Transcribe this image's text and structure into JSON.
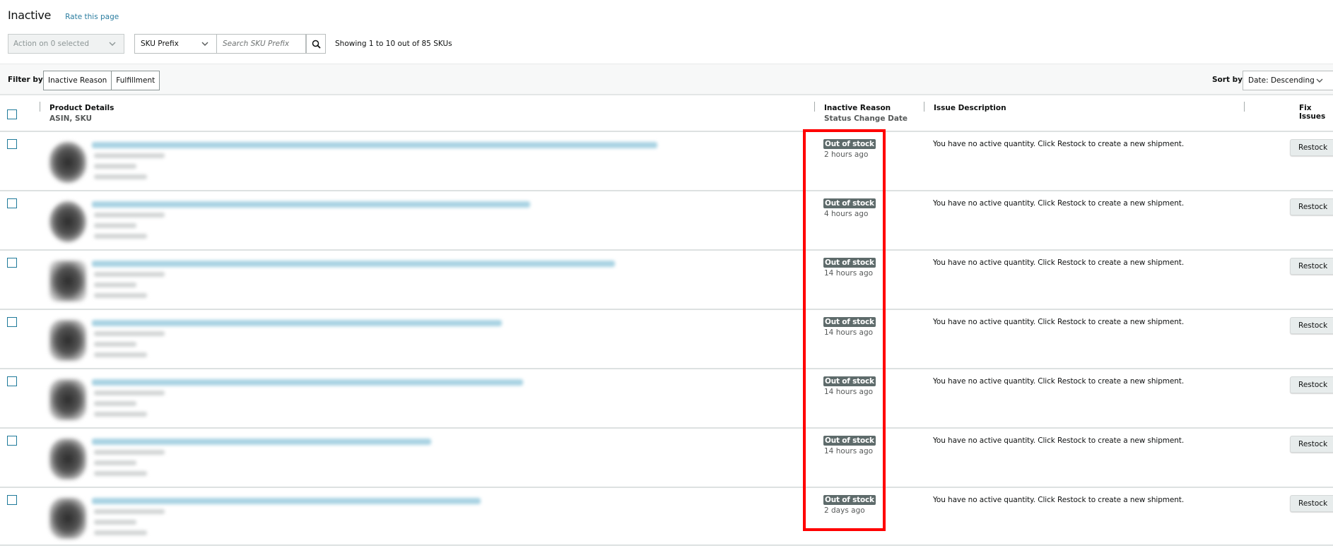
{
  "header": {
    "title": "Inactive",
    "rate_link": "Rate this page"
  },
  "toolbar": {
    "action_select": "Action on 0 selected",
    "sku_select": "SKU Prefix",
    "search_placeholder": "Search SKU Prefix",
    "search_icon": "search-icon",
    "showing_text": "Showing 1 to 10 out of 85 SKUs"
  },
  "filters": {
    "label": "Filter by",
    "buttons": [
      "Inactive Reason",
      "Fulfillment"
    ],
    "sort_label": "Sort by",
    "sort_value": "Date: Descending"
  },
  "table": {
    "columns": {
      "product": "Product Details",
      "product_sub": "ASIN, SKU",
      "reason": "Inactive Reason",
      "reason_sub": "Status Change Date",
      "issue": "Issue Description",
      "fix": "Fix Issues"
    },
    "rows": [
      {
        "status": "Out of stock",
        "date": "2 hours ago",
        "issue": "You have no active quantity. Click Restock to create a new shipment.",
        "action": "Restock"
      },
      {
        "status": "Out of stock",
        "date": "4 hours ago",
        "issue": "You have no active quantity. Click Restock to create a new shipment.",
        "action": "Restock"
      },
      {
        "status": "Out of stock",
        "date": "14 hours ago",
        "issue": "You have no active quantity. Click Restock to create a new shipment.",
        "action": "Restock"
      },
      {
        "status": "Out of stock",
        "date": "14 hours ago",
        "issue": "You have no active quantity. Click Restock to create a new shipment.",
        "action": "Restock"
      },
      {
        "status": "Out of stock",
        "date": "14 hours ago",
        "issue": "You have no active quantity. Click Restock to create a new shipment.",
        "action": "Restock"
      },
      {
        "status": "Out of stock",
        "date": "14 hours ago",
        "issue": "You have no active quantity. Click Restock to create a new shipment.",
        "action": "Restock"
      },
      {
        "status": "Out of stock",
        "date": "2 days ago",
        "issue": "You have no active quantity. Click Restock to create a new shipment.",
        "action": "Restock"
      }
    ]
  },
  "colors": {
    "link": "#2b7da0",
    "badge_bg": "#5e6b6b",
    "highlight": "#ff0000",
    "checkbox": "#1f7a9a"
  }
}
